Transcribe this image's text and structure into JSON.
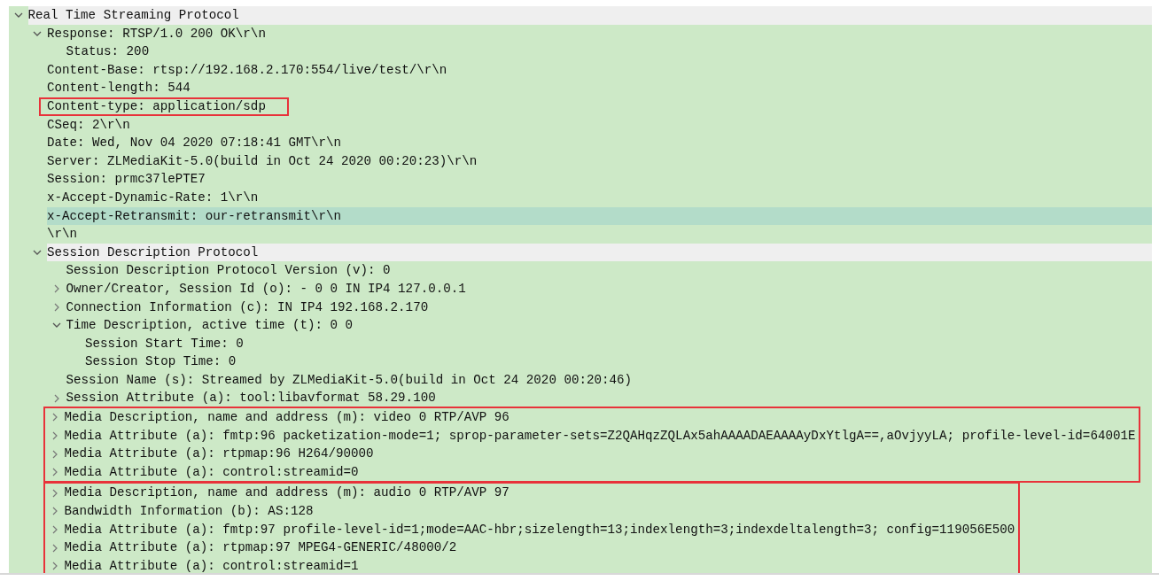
{
  "tree": [
    {
      "kind": "protocol",
      "text": "Real Time Streaming Protocol",
      "expanded": true,
      "selected": false,
      "children": [
        {
          "kind": "field",
          "text": "Response: RTSP/1.0 200 OK\\r\\n",
          "expanded": true,
          "selected": false,
          "children": [
            {
              "kind": "field",
              "text": "Status: 200",
              "selected": false
            }
          ]
        },
        {
          "kind": "field",
          "text": "Content-Base: rtsp://192.168.2.170:554/live/test/\\r\\n",
          "selected": false
        },
        {
          "kind": "field",
          "text": "Content-length: 544",
          "selected": false
        },
        {
          "kind": "field",
          "text": "Content-type: application/sdp",
          "selected": false,
          "boxed": true
        },
        {
          "kind": "field",
          "text": "CSeq: 2\\r\\n",
          "selected": false
        },
        {
          "kind": "field",
          "text": "Date: Wed, Nov 04 2020 07:18:41 GMT\\r\\n",
          "selected": false
        },
        {
          "kind": "field",
          "text": "Server: ZLMediaKit-5.0(build in Oct 24 2020 00:20:23)\\r\\n",
          "selected": false
        },
        {
          "kind": "field",
          "text": "Session: prmc37lePTE7",
          "selected": false
        },
        {
          "kind": "field",
          "text": "x-Accept-Dynamic-Rate: 1\\r\\n",
          "selected": false
        },
        {
          "kind": "field",
          "text": "x-Accept-Retransmit: our-retransmit\\r\\n",
          "selected": true
        },
        {
          "kind": "field",
          "text": "\\r\\n",
          "selected": false
        },
        {
          "kind": "protocol",
          "text": "Session Description Protocol",
          "expanded": true,
          "selected": false,
          "children": [
            {
              "kind": "field",
              "text": "Session Description Protocol Version (v): 0",
              "selected": false
            },
            {
              "kind": "field",
              "text": "Owner/Creator, Session Id (o): - 0 0 IN IP4 127.0.0.1",
              "expanded": false,
              "selected": false
            },
            {
              "kind": "field",
              "text": "Connection Information (c): IN IP4 192.168.2.170",
              "expanded": false,
              "selected": false
            },
            {
              "kind": "field",
              "text": "Time Description, active time (t): 0 0",
              "expanded": true,
              "selected": false,
              "children": [
                {
                  "kind": "field",
                  "text": "Session Start Time: 0",
                  "selected": false
                },
                {
                  "kind": "field",
                  "text": "Session Stop Time: 0",
                  "selected": false
                }
              ]
            },
            {
              "kind": "field",
              "text": "Session Name (s): Streamed by ZLMediaKit-5.0(build in Oct 24 2020 00:20:46)",
              "selected": false
            },
            {
              "kind": "field",
              "text": "Session Attribute (a): tool:libavformat 58.29.100",
              "expanded": false,
              "selected": false
            },
            {
              "kind": "boxed_group",
              "items": [
                {
                  "kind": "field",
                  "text": "Media Description, name and address (m): video 0 RTP/AVP 96",
                  "expanded": false,
                  "selected": false
                },
                {
                  "kind": "field",
                  "text": "Media Attribute (a): fmtp:96 packetization-mode=1; sprop-parameter-sets=Z2QAHqzZQLAx5ahAAAADAEAAAAyDxYtlgA==,aOvjyyLA; profile-level-id=64001E",
                  "expanded": false,
                  "selected": false
                },
                {
                  "kind": "field",
                  "text": "Media Attribute (a): rtpmap:96 H264/90000",
                  "expanded": false,
                  "selected": false
                },
                {
                  "kind": "field",
                  "text": "Media Attribute (a): control:streamid=0",
                  "expanded": false,
                  "selected": false
                }
              ]
            },
            {
              "kind": "boxed_group",
              "items": [
                {
                  "kind": "field",
                  "text": "Media Description, name and address (m): audio 0 RTP/AVP 97",
                  "expanded": false,
                  "selected": false
                },
                {
                  "kind": "field",
                  "text": "Bandwidth Information (b): AS:128",
                  "expanded": false,
                  "selected": false
                },
                {
                  "kind": "field",
                  "text": "Media Attribute (a): fmtp:97 profile-level-id=1;mode=AAC-hbr;sizelength=13;indexlength=3;indexdeltalength=3; config=119056E500",
                  "expanded": false,
                  "selected": false
                },
                {
                  "kind": "field",
                  "text": "Media Attribute (a): rtpmap:97 MPEG4-GENERIC/48000/2",
                  "expanded": false,
                  "selected": false
                },
                {
                  "kind": "field",
                  "text": "Media Attribute (a): control:streamid=1",
                  "expanded": false,
                  "selected": false
                }
              ]
            }
          ]
        }
      ]
    }
  ]
}
